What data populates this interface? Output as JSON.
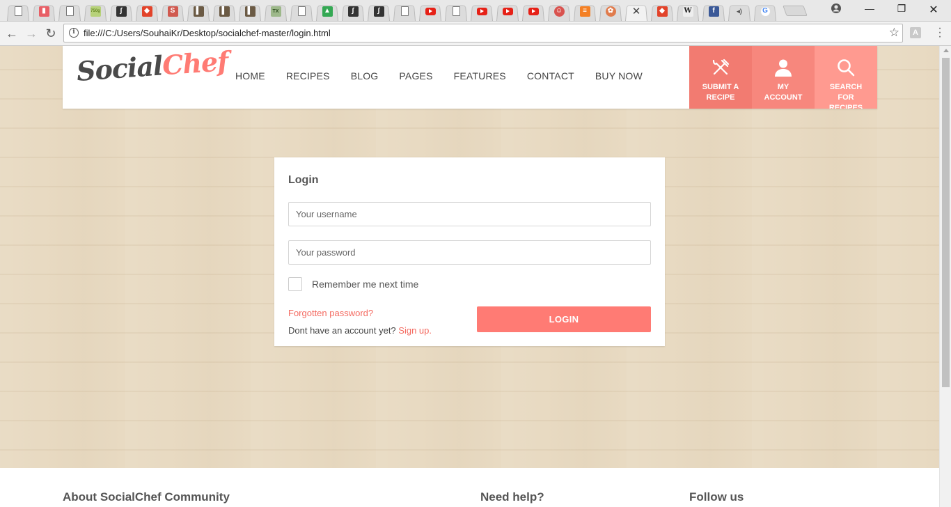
{
  "browser": {
    "tabs": [
      {
        "icon": "page-icon",
        "color": "#ffffff",
        "glyph": ""
      },
      {
        "icon": "stats-icon",
        "color": "#e85f66",
        "glyph": "▮"
      },
      {
        "icon": "page-icon",
        "color": "#ffffff",
        "glyph": ""
      },
      {
        "icon": "750g-icon",
        "color": "#b7d27a",
        "glyph": "750g"
      },
      {
        "icon": "symfony-icon",
        "color": "#333333",
        "glyph": "∫"
      },
      {
        "icon": "gitlab-icon",
        "color": "#e2432a",
        "glyph": "◆"
      },
      {
        "icon": "s-icon",
        "color": "#d0594f",
        "glyph": "S"
      },
      {
        "icon": "book-icon",
        "color": "#6b5a44",
        "glyph": "▌"
      },
      {
        "icon": "book-icon",
        "color": "#6b5a44",
        "glyph": "▌"
      },
      {
        "icon": "book-icon",
        "color": "#6b5a44",
        "glyph": "▌"
      },
      {
        "icon": "tex-icon",
        "color": "#9db88a",
        "glyph": "TX"
      },
      {
        "icon": "page-icon",
        "color": "#ffffff",
        "glyph": ""
      },
      {
        "icon": "google-drive-icon",
        "color": "#34a853",
        "glyph": "▲"
      },
      {
        "icon": "symfony-icon",
        "color": "#333333",
        "glyph": "∫"
      },
      {
        "icon": "symfony-icon",
        "color": "#333333",
        "glyph": "∫"
      },
      {
        "icon": "page-icon",
        "color": "#ffffff",
        "glyph": ""
      },
      {
        "icon": "youtube-icon",
        "color": "#e62117",
        "glyph": ""
      },
      {
        "icon": "page-icon",
        "color": "#ffffff",
        "glyph": ""
      },
      {
        "icon": "youtube-icon",
        "color": "#e62117",
        "glyph": ""
      },
      {
        "icon": "youtube-icon",
        "color": "#e62117",
        "glyph": ""
      },
      {
        "icon": "youtube-icon",
        "color": "#e62117",
        "glyph": ""
      },
      {
        "icon": "reddit-icon",
        "color": "#d9534f",
        "glyph": "☺"
      },
      {
        "icon": "stackoverflow-icon",
        "color": "#f48024",
        "glyph": "≡"
      },
      {
        "icon": "cookie-icon",
        "color": "#e07b4c",
        "glyph": "✿"
      },
      {
        "icon": "close-icon",
        "color": "",
        "glyph": "",
        "active": true
      },
      {
        "icon": "gitlab-icon",
        "color": "#e2432a",
        "glyph": "◆"
      },
      {
        "icon": "wikipedia-icon",
        "color": "#eeeeee",
        "glyph": "W"
      },
      {
        "icon": "facebook-icon",
        "color": "#3b5998",
        "glyph": "f"
      },
      {
        "icon": "audio-icon",
        "color": "",
        "glyph": "◂)"
      },
      {
        "icon": "google-icon",
        "color": "#ffffff",
        "glyph": "G"
      }
    ],
    "url": "file:///C:/Users/SouhaiKr/Desktop/socialchef-master/login.html"
  },
  "site": {
    "logo_part1": "Social",
    "logo_part2": "Chef",
    "nav": [
      "HOME",
      "RECIPES",
      "BLOG",
      "PAGES",
      "FEATURES",
      "CONTACT",
      "BUY NOW"
    ],
    "header_buttons": [
      {
        "label": "SUBMIT A RECIPE",
        "icon": "fork-knife-icon"
      },
      {
        "label": "MY ACCOUNT",
        "icon": "user-icon"
      },
      {
        "label": "SEARCH FOR RECIPES",
        "icon": "search-icon"
      }
    ]
  },
  "login": {
    "title": "Login",
    "username_placeholder": "Your username",
    "password_placeholder": "Your password",
    "remember_label": "Remember me next time",
    "forgot_label": "Forgotten password?",
    "no_account_text": "Dont have an account yet?",
    "signup_label": "Sign up.",
    "button_label": "LOGIN"
  },
  "footer": {
    "about_title": "About SocialChef Community",
    "help_title": "Need help?",
    "follow_title": "Follow us"
  },
  "colors": {
    "accent": "#ff7b74",
    "background_wood": "#e8dac2"
  }
}
